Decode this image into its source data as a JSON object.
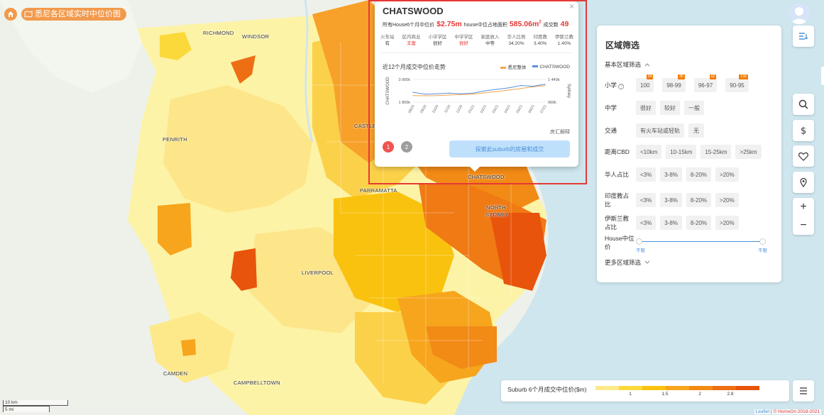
{
  "breadcrumb": {
    "title": "悉尼各区域实时中位价图",
    "home_icon": "home-icon"
  },
  "map_labels": {
    "richmond": "RICHMOND",
    "windsor": "WINDSOR",
    "penrith": "PENRITH",
    "castle_hill": "CASTLE HILL",
    "parramatta": "PARRAMATTA",
    "chatswood": "CHATSWOOD",
    "north_sydney": "NORTH SYDNEY",
    "liverpool": "LIVERPOOL",
    "camden": "CAMDEN",
    "campbelltown": "CAMPBELLTOWN"
  },
  "popup": {
    "suburb": "CHATSWOOD",
    "median_label": "所有House6个月中位价",
    "median_value": "$2.75m",
    "land_label": "house中位占地面积",
    "land_value": "585.06m",
    "land_unit_sup": "2",
    "deals_label": "成交数",
    "deals_value": "49",
    "attributes": [
      {
        "label": "火车站",
        "value": "有",
        "highlight": false
      },
      {
        "label": "区内商业",
        "value": "丰富",
        "highlight": true
      },
      {
        "label": "小学学区",
        "value": "很好",
        "highlight": false
      },
      {
        "label": "中学学区",
        "value": "很好",
        "highlight": true
      },
      {
        "label": "家庭收入",
        "value": "中等",
        "highlight": false
      },
      {
        "label": "华人比例",
        "value": "34.20%",
        "highlight": false
      },
      {
        "label": "印度教",
        "value": "3.40%",
        "highlight": false
      },
      {
        "label": "伊斯兰教",
        "value": "1.40%",
        "highlight": false
      }
    ],
    "trend_title": "近12个月成交中位价走势",
    "legend": [
      {
        "name": "悉尼整体",
        "color": "#f4a54a"
      },
      {
        "name": "CHATSWOOD",
        "color": "#5b8fe0"
      }
    ],
    "chart_note": "房汇解释",
    "pager": [
      "1",
      "2"
    ],
    "explore_button": "探索此suburb的房屋和成交",
    "close_icon": "close-icon"
  },
  "chart_data": {
    "type": "line",
    "title": "近12个月成交中位价走势",
    "x": [
      "08/20",
      "09/20",
      "10/20",
      "11/20",
      "12/20",
      "01/21",
      "02/21",
      "03/21",
      "04/21",
      "05/21",
      "06/21",
      "07/21"
    ],
    "left_axis": {
      "label": "CHATSWOOD",
      "ticks": [
        "3 000k",
        "1 800k"
      ],
      "range": [
        1800,
        3000
      ]
    },
    "right_axis": {
      "label": "Sydney",
      "ticks": [
        "1 440k",
        "960k"
      ],
      "range": [
        960,
        1440
      ]
    },
    "series": [
      {
        "name": "悉尼整体",
        "axis": "right",
        "color": "#f4a54a",
        "values": [
          1100,
          1095,
          1100,
          1110,
          1120,
          1130,
          1160,
          1185,
          1215,
          1250,
          1285,
          1310
        ]
      },
      {
        "name": "CHATSWOOD",
        "axis": "left",
        "color": "#5b8fe0",
        "values": [
          2320,
          2220,
          2240,
          2280,
          2240,
          2280,
          2400,
          2480,
          2560,
          2680,
          2640,
          2750
        ]
      }
    ],
    "grid": true
  },
  "panel": {
    "title": "区域筛选",
    "basic_label": "基本区域筛选",
    "rows": [
      {
        "label": "小学",
        "has_help": true,
        "options": [
          {
            "text": "100",
            "badge": "34"
          },
          {
            "text": "98-99",
            "badge": "35"
          },
          {
            "text": "96-97",
            "badge": "62"
          },
          {
            "text": "90-95",
            "badge": "139"
          }
        ]
      },
      {
        "label": "中学",
        "options": [
          {
            "text": "很好"
          },
          {
            "text": "较好"
          },
          {
            "text": "一般"
          }
        ]
      },
      {
        "label": "交通",
        "options": [
          {
            "text": "有火车站或轻轨"
          },
          {
            "text": "无"
          }
        ]
      },
      {
        "label": "距离CBD",
        "options": [
          {
            "text": "<10km"
          },
          {
            "text": "10-15km"
          },
          {
            "text": "15-25km"
          },
          {
            "text": ">25km"
          }
        ]
      },
      {
        "label": "华人占比",
        "options": [
          {
            "text": "<3%"
          },
          {
            "text": "3-8%"
          },
          {
            "text": "8-20%"
          },
          {
            "text": ">20%"
          }
        ]
      },
      {
        "label": "印度教占比",
        "options": [
          {
            "text": "<3%"
          },
          {
            "text": "3-8%"
          },
          {
            "text": "8-20%"
          },
          {
            "text": ">20%"
          }
        ]
      },
      {
        "label": "伊斯兰教占比",
        "options": [
          {
            "text": "<3%"
          },
          {
            "text": "3-8%"
          },
          {
            "text": "8-20%"
          },
          {
            "text": ">20%"
          }
        ]
      }
    ],
    "price_label": "House中位价",
    "price_min": "不限",
    "price_max": "不限",
    "more_label": "更多区域筛选"
  },
  "legend": {
    "title": "Suburb 6个月成交中位价($m)",
    "colors": [
      "#fde98a",
      "#fbd93a",
      "#f9c20f",
      "#f6a51d",
      "#f28a16",
      "#ee6e13",
      "#e8540c"
    ],
    "ticks": [
      "1",
      "1.5",
      "2",
      "2.8"
    ]
  },
  "scale": {
    "km": "10 km",
    "mi": "5 mi"
  },
  "attribution": {
    "leaflet": "Leaflet",
    "sep": " | ",
    "brand": "© HomeOn 2018-2021"
  },
  "controls": [
    "search-icon",
    "dollar-icon",
    "heart-icon",
    "bookmark-icon"
  ]
}
